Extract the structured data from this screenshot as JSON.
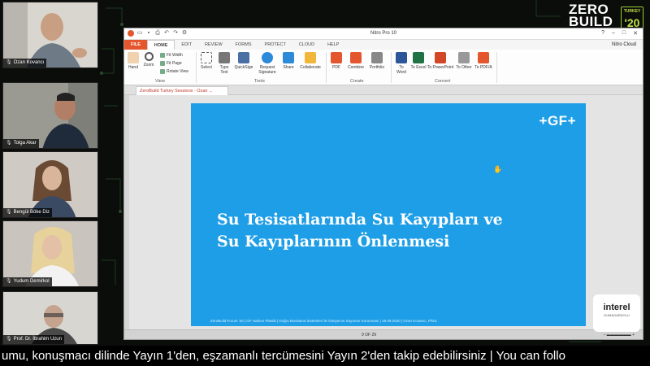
{
  "participants": [
    {
      "name": "Ozan Kovancı",
      "bg": "#d9d6cf"
    },
    {
      "name": "Tolga Akar",
      "bg": "#9a9a92"
    },
    {
      "name": "Bengül Böke Diz",
      "bg": "#cfcac3"
    },
    {
      "name": "Yudum Demirkol",
      "bg": "#c9c4bd"
    },
    {
      "name": "Prof. Dr. İbrahim Uzun",
      "bg": "#d8d6d0"
    }
  ],
  "event_logo": {
    "line1": "ZERO",
    "line2": "BUILD",
    "badge_top": "TURKEY",
    "badge_year": "'20"
  },
  "app": {
    "title": "Nitro Pro 10",
    "cloud_user": "Nitro Cloud",
    "tabs": [
      "FILE",
      "HOME",
      "EDIT",
      "REVIEW",
      "FORMS",
      "PROTECT",
      "CLOUD",
      "HELP"
    ],
    "ribbon": {
      "hand": "Hand",
      "zoom": "Zoom",
      "fit_width": "Fit Width",
      "fit_page": "Fit Page",
      "rotate_view": "Rotate View",
      "view_group": "View",
      "select": "Select",
      "type_text": "Type Text",
      "quicksign": "QuickSign",
      "request_signature": "Request Signature",
      "share": "Share",
      "collaborate": "Collaborate",
      "tools_group": "Tools",
      "pdf": "PDF",
      "combine": "Combine",
      "portfolio": "Portfolio",
      "create_group": "Create",
      "to_word": "To Word",
      "to_excel": "To Excel",
      "to_powerpoint": "To PowerPoint",
      "to_other": "To Other",
      "to_pdfa": "To PDF/A",
      "convert_group": "Convert"
    },
    "doc_tab": "ZeroBuild Turkey Sessions - Ozan ...",
    "status_pages": "9 OF 29"
  },
  "slide": {
    "logo": "+GF+",
    "title_line1": "Su Tesisatlarında Su Kayıpları ve",
    "title_line2": "Su Kayıplarının Önlenmesi",
    "footer": "ZeroBuild Forum '20 | GF Harkon Plastik | Doğru Borulama Sistemleri ile Dünya'nın Suyunun Korunması | 28.09.2020 | Ozan Kovancı, PhDc"
  },
  "sponsor": {
    "brand": "interel",
    "sub": "DUMAGARDOLU"
  },
  "ticker": "umu, konuşmacı dilinde Yayın 1'den, eşzamanlı tercümesini Yayın 2'den takip edebilirsiniz | You can follo",
  "colors": {
    "nitro_accent": "#e4572e",
    "slide_blue": "#1e9ee6",
    "zero_green": "#bfe04a"
  }
}
